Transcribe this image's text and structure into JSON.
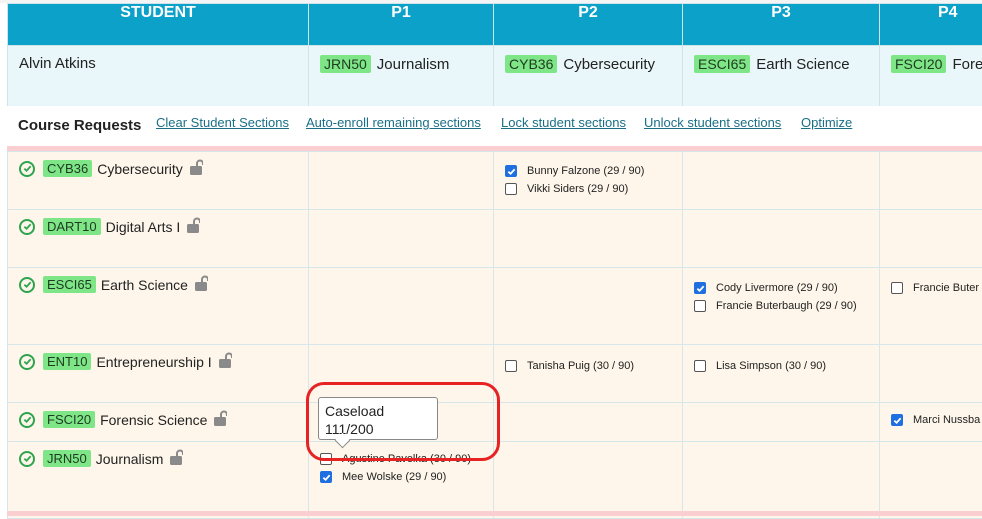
{
  "header": {
    "student": "STUDENT",
    "periods": [
      "P1",
      "P2",
      "P3",
      "P4"
    ]
  },
  "student": {
    "name": "Alvin Atkins",
    "assignments": [
      {
        "code": "JRN50",
        "name": "Journalism"
      },
      {
        "code": "CYB36",
        "name": "Cybersecurity"
      },
      {
        "code": "ESCI65",
        "name": "Earth Science"
      },
      {
        "code": "FSCI20",
        "name": "Fore"
      }
    ]
  },
  "requests": {
    "title": "Course Requests",
    "links": {
      "clear": "Clear Student Sections",
      "auto": "Auto-enroll remaining sections",
      "lock": "Lock student sections",
      "unlock": "Unlock student sections",
      "optimize": "Optimize"
    },
    "courses": [
      {
        "code": "CYB36",
        "name": "Cybersecurity",
        "p2": [
          {
            "label": "Bunny Falzone (29 / 90)",
            "checked": true
          },
          {
            "label": "Vikki Siders (29 / 90)",
            "checked": false
          }
        ]
      },
      {
        "code": "DART10",
        "name": "Digital Arts I"
      },
      {
        "code": "ESCI65",
        "name": "Earth Science",
        "p3": [
          {
            "label": "Cody Livermore (29 / 90)",
            "checked": true
          },
          {
            "label": "Francie Buterbaugh (29 / 90)",
            "checked": false
          }
        ],
        "p4": [
          {
            "label": "Francie Buter",
            "checked": false
          }
        ]
      },
      {
        "code": "ENT10",
        "name": "Entrepreneurship I",
        "p2": [
          {
            "label": "Tanisha Puig (30 / 90)",
            "checked": false
          }
        ],
        "p3": [
          {
            "label": "Lisa Simpson (30 / 90)",
            "checked": false
          }
        ]
      },
      {
        "code": "FSCI20",
        "name": "Forensic Science",
        "p4": [
          {
            "label": "Marci Nussba",
            "checked": true
          }
        ]
      },
      {
        "code": "JRN50",
        "name": "Journalism",
        "p1": [
          {
            "label": "Agustine Pavelka (30 / 90)",
            "checked": false
          },
          {
            "label": "Mee Wolske (29 / 90)",
            "checked": true
          }
        ]
      }
    ]
  },
  "tooltip": {
    "line1": "Caseload",
    "line2": "111/200"
  },
  "colors": {
    "header": "#0ca1c9",
    "code_bg": "#7ee687",
    "check_green": "#2ea44f",
    "highlight_ring": "#e62222",
    "checkbox_on": "#1f6fe0"
  }
}
